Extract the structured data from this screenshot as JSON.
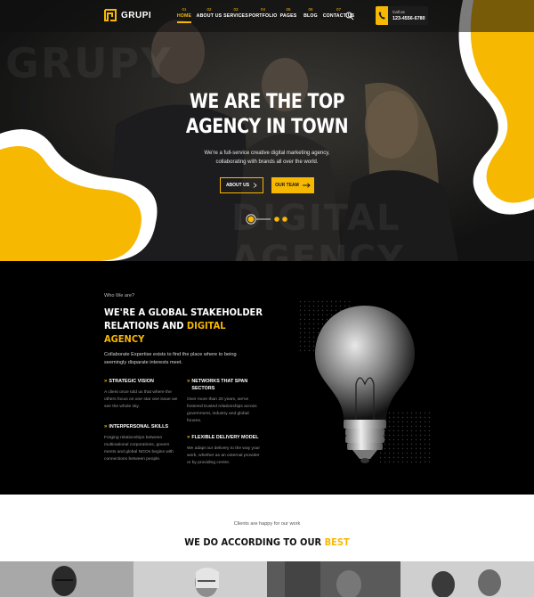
{
  "brand": {
    "logo_text": "GRUPI",
    "accent_color": "#f7b801"
  },
  "nav": {
    "items": [
      {
        "num": "01",
        "label": "HOME",
        "active": true
      },
      {
        "num": "02",
        "label": "ABOUT US"
      },
      {
        "num": "03",
        "label": "SERVICES"
      },
      {
        "num": "04",
        "label": "PORTFOLIO"
      },
      {
        "num": "05",
        "label": "PAGES"
      },
      {
        "num": "06",
        "label": "BLOG"
      },
      {
        "num": "07",
        "label": "CONTACT US"
      }
    ],
    "search_icon": "search-icon",
    "call": {
      "label": "Call us",
      "number": "123-4556-6780",
      "icon": "phone-icon"
    }
  },
  "hero": {
    "watermark_top": "GRUPY",
    "watermark_bottom": "DIGITAL AGENCY",
    "title_line1": "WE ARE THE TOP",
    "title_line2": "AGENCY IN TOWN",
    "subtitle_line1": "We're a full-service creative digital marketing agency,",
    "subtitle_line2": "collaborating with brands all over the world.",
    "about_button": "ABOUT US",
    "team_button": "OUR TEAM"
  },
  "about": {
    "eyebrow": "Who We are?",
    "heading_line1": "WE'RE A GLOBAL STAKEHOLDER",
    "heading_line2_plain": "RELATIONS AND ",
    "heading_line2_accent": "DIGITAL",
    "heading_line3_accent": "AGENCY",
    "desc_line1": "Collaborate Expertise exists to find the place where to being",
    "desc_line2": "seemingly disparate interests meet.",
    "features": [
      {
        "title": [
          "STRATEGIC VISION"
        ],
        "text": [
          "A client once told us that where the",
          "others focus on one star one issue we",
          "see the whole sky."
        ]
      },
      {
        "title": [
          "NETWORKS THAT SPAN",
          "SECTORS"
        ],
        "text": [
          "Over more than 20 years, we've",
          "fostered trusted relationships across",
          "government, industry and global",
          "forums."
        ]
      },
      {
        "title": [
          "INTERPERSONAL SKILLS"
        ],
        "text": [
          "Forging relationships between",
          "multinational corporations, govern",
          "ments and global NGOs begins with",
          "connections between people."
        ]
      },
      {
        "title": [
          "FLEXIBLE DELIVERY MODEL"
        ],
        "text": [
          "We adapt our delivery to the way your",
          "work, whether as an external provider",
          "or by providing centre."
        ]
      }
    ]
  },
  "clients": {
    "eyebrow": "Clients are happy for our work",
    "title_plain": "WE DO ACCORDING TO OUR ",
    "title_accent": "BEST"
  }
}
